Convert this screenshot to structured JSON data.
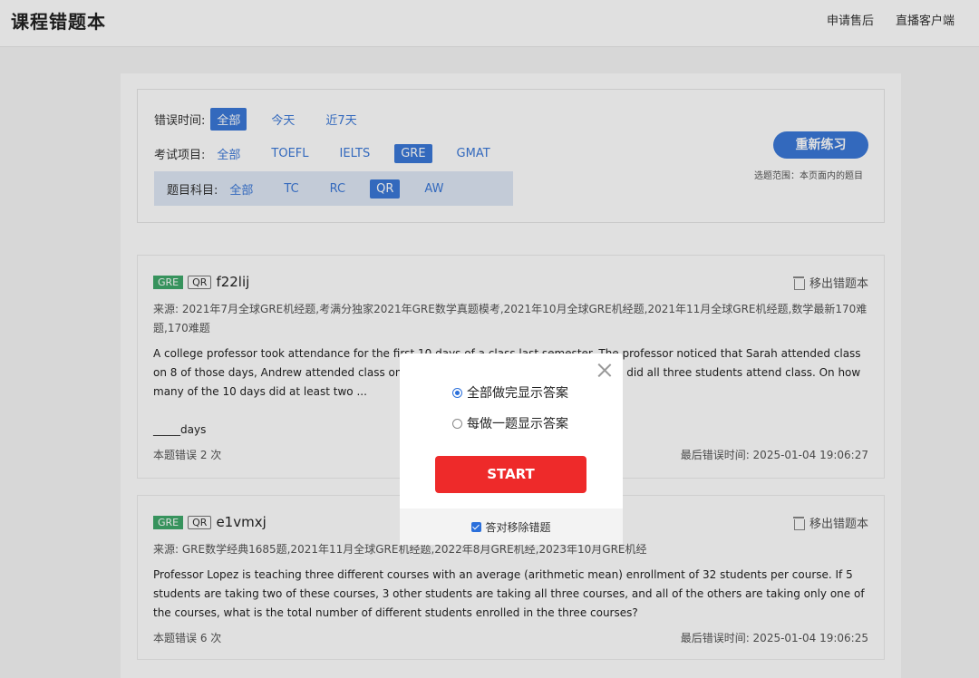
{
  "header": {
    "title": "课程错题本",
    "nav": [
      "申请售后",
      "直播客户端"
    ]
  },
  "filters": {
    "time": {
      "label": "错误时间:",
      "options": [
        "全部",
        "今天",
        "近7天"
      ],
      "selected": "全部"
    },
    "exam": {
      "label": "考试项目:",
      "options": [
        "全部",
        "TOEFL",
        "IELTS",
        "GRE",
        "GMAT"
      ],
      "selected": "GRE"
    },
    "subject": {
      "label": "题目科目:",
      "options": [
        "全部",
        "TC",
        "RC",
        "QR",
        "AW"
      ],
      "selected": "QR"
    },
    "redo_button": "重新练习",
    "redo_hint": "选题范围：本页面内的题目"
  },
  "questions": [
    {
      "exam_tag": "GRE",
      "subject_tag": "QR",
      "id": "f22lij",
      "remove_label": "移出错题本",
      "source": "来源:  2021年7月全球GRE机经题,考满分独家2021年GRE数学真题模考,2021年10月全球GRE机经题,2021年11月全球GRE机经题,数学最新170难题,170难题",
      "text": "A college professor took attendance for the first 10 days of a class last semester. The professor noticed that Sarah attended class on 8 of those days, Andrew attended class on 7 of those days, J... only 1 of those days did all three students attend class. On how many of the 10 days did at least two ...",
      "blank": "_____days",
      "error_count": "本题错误 2 次",
      "last_time": "最后错误时间:  2025-01-04 19:06:27"
    },
    {
      "exam_tag": "GRE",
      "subject_tag": "QR",
      "id": "e1vmxj",
      "remove_label": "移出错题本",
      "source": "来源:  GRE数学经典1685题,2021年11月全球GRE机经题,2022年8月GRE机经,2023年10月GRE机经",
      "text": "Professor Lopez is teaching three different courses with an average (arithmetic mean) enrollment of 32 students per course. If 5 students are taking two of these courses, 3 other students are taking all three courses, and all of the others are taking only one of the courses, what is the total number of different students enrolled in the three courses?",
      "error_count": "本题错误 6 次",
      "last_time": "最后错误时间:  2025-01-04 19:06:25"
    }
  ],
  "modal": {
    "option_all": "全部做完显示答案",
    "option_each": "每做一题显示答案",
    "selected": "全部做完显示答案",
    "start": "START",
    "remove_on_correct": "答对移除错题",
    "remove_on_correct_checked": true
  }
}
